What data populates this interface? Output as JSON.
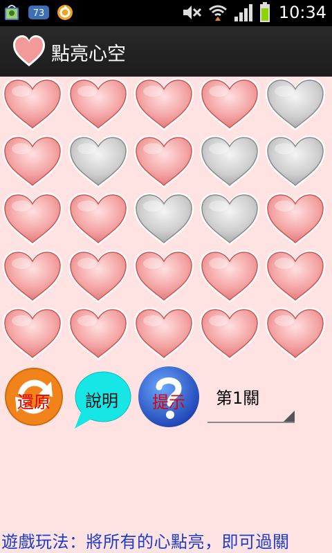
{
  "status_bar": {
    "time": "10:34",
    "badge_count": "73",
    "icons": [
      "android-market-icon",
      "notification-count-icon",
      "sync-icon",
      "mute-icon",
      "wifi-icon",
      "signal-icon",
      "battery-icon"
    ]
  },
  "app": {
    "title": "點亮心空",
    "icon": "heart-icon"
  },
  "board": {
    "rows": 5,
    "cols": 5,
    "cells": [
      [
        "lit",
        "lit",
        "lit",
        "lit",
        "unlit"
      ],
      [
        "lit",
        "unlit",
        "lit",
        "unlit",
        "unlit"
      ],
      [
        "lit",
        "lit",
        "unlit",
        "unlit",
        "lit"
      ],
      [
        "lit",
        "lit",
        "lit",
        "lit",
        "lit"
      ],
      [
        "lit",
        "lit",
        "lit",
        "lit",
        "lit"
      ]
    ],
    "colors": {
      "lit": "#f08a8a",
      "unlit": "#c8c8c8"
    }
  },
  "controls": {
    "reset_label": "還原",
    "help_label": "說明",
    "hint_label": "提示",
    "level_selected": "第1關"
  },
  "footer": {
    "instructions": "遊戲玩法：將所有的心點亮，即可過關"
  }
}
